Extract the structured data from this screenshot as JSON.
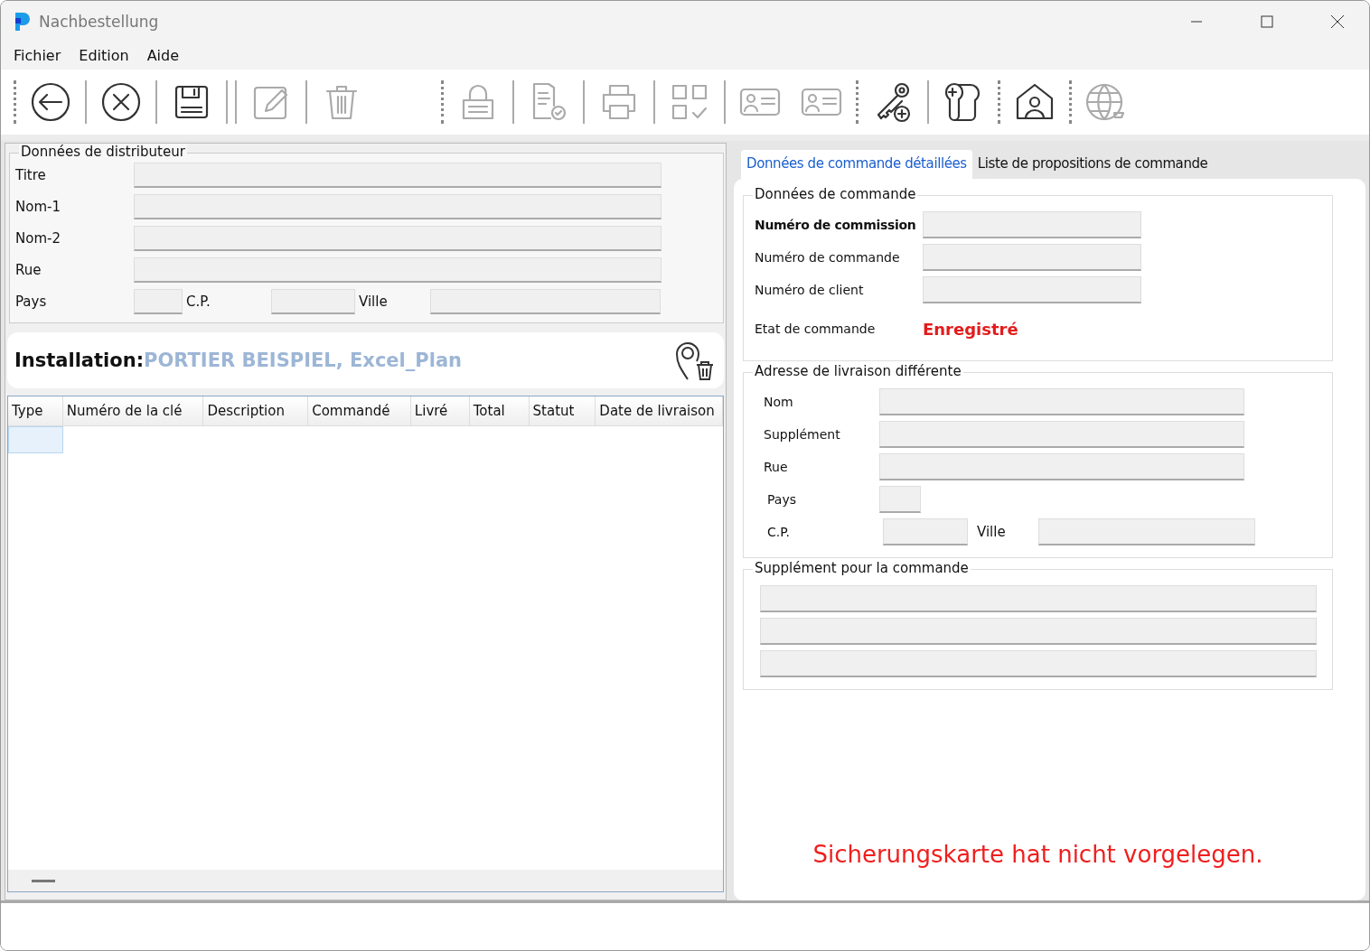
{
  "window": {
    "title": "Nachbestellung"
  },
  "menu": [
    "Fichier",
    "Edition",
    "Aide"
  ],
  "toolbar": [
    {
      "items": [
        {
          "kind": "dotted-divider"
        },
        {
          "kind": "back",
          "disabled": false
        },
        {
          "kind": "solid-divider"
        },
        {
          "kind": "cancel",
          "disabled": false
        },
        {
          "kind": "solid-divider"
        },
        {
          "kind": "save",
          "disabled": false
        },
        {
          "kind": "solid-divider"
        },
        {
          "kind": "solid-divider"
        },
        {
          "kind": "edit",
          "disabled": true
        },
        {
          "kind": "solid-divider"
        },
        {
          "kind": "trash",
          "disabled": true
        }
      ]
    },
    {
      "items": [
        {
          "kind": "dotted-divider"
        },
        {
          "kind": "lock",
          "disabled": true
        },
        {
          "kind": "solid-divider"
        },
        {
          "kind": "doc-check",
          "disabled": true
        },
        {
          "kind": "solid-divider"
        },
        {
          "kind": "print",
          "disabled": true
        },
        {
          "kind": "solid-divider"
        },
        {
          "kind": "grid-check",
          "disabled": true
        },
        {
          "kind": "solid-divider"
        },
        {
          "kind": "id-card",
          "disabled": true
        },
        {
          "kind": "id-card",
          "disabled": true
        },
        {
          "kind": "dotted-divider"
        },
        {
          "kind": "key-plus",
          "disabled": false
        },
        {
          "kind": "solid-divider"
        },
        {
          "kind": "cylinder",
          "disabled": false
        },
        {
          "kind": "dotted-divider"
        },
        {
          "kind": "house",
          "disabled": false
        },
        {
          "kind": "dotted-divider"
        },
        {
          "kind": "globe-cart",
          "disabled": true
        }
      ]
    }
  ],
  "distributor": {
    "title": "Données de distributeur",
    "fields": [
      {
        "label": "Titre"
      },
      {
        "label": "Nom-1"
      },
      {
        "label": "Nom-2"
      },
      {
        "label": "Rue"
      }
    ],
    "country_label": "Pays",
    "postal_label": "C.P.",
    "city_label": "Ville"
  },
  "installation": {
    "label": "Installation:",
    "value": "PORTIER BEISPIEL, Excel_Plan"
  },
  "table": {
    "columns": [
      "Type",
      "Numéro de la clé",
      "Description",
      "Commandé",
      "Livré",
      "Total",
      "Statut",
      "Date de livraison"
    ],
    "rows": [
      {
        "selected": true
      }
    ]
  },
  "tabs": [
    {
      "label": "Données de commande détaillées",
      "selected": true
    },
    {
      "label": "Liste de propositions de commande",
      "selected": false
    }
  ],
  "order": {
    "title": "Données de commande",
    "fields": [
      {
        "label": "Numéro de commission",
        "bold": true
      },
      {
        "label": "Numéro de commande",
        "bold": false
      },
      {
        "label": "Numéro de client",
        "bold": false
      }
    ],
    "status_label": "Etat de commande",
    "status": "Enregistré"
  },
  "delivery": {
    "title": "Adresse de livraison différente",
    "fields": [
      {
        "label": "Nom"
      },
      {
        "label": "Supplément"
      },
      {
        "label": "Rue"
      }
    ],
    "country_label": "Pays",
    "postal_label": "C.P.",
    "city_label": "Ville"
  },
  "supplement": {
    "title": "Supplément pour la commande"
  },
  "message": "Sicherungskarte hat nicht vorgelegen."
}
